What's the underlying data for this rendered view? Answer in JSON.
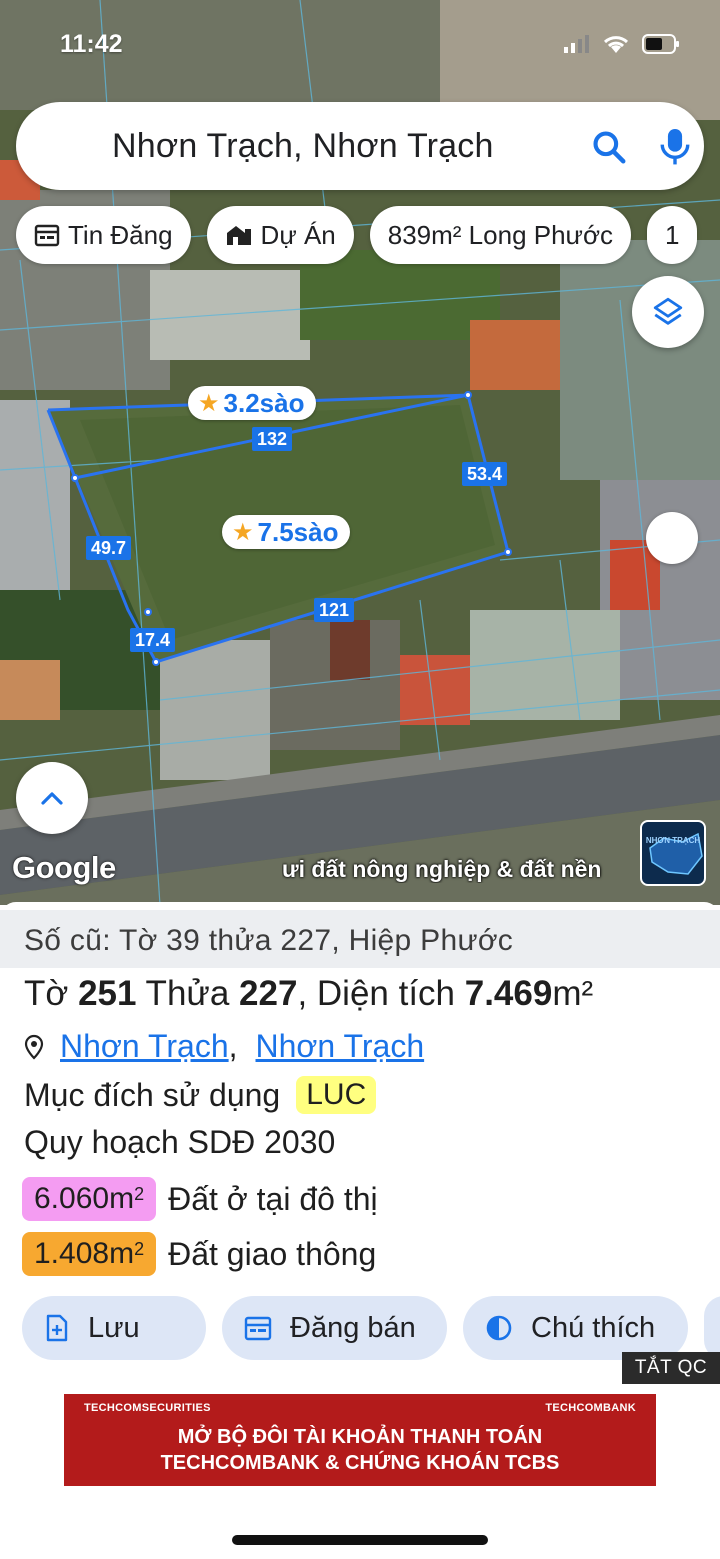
{
  "status_bar": {
    "time": "11:42"
  },
  "search": {
    "text": "Nhơn Trạch, Nhơn Trạch",
    "icon": "search-icon",
    "voice_icon": "mic-icon"
  },
  "chips": [
    {
      "label": "Tin Đăng",
      "icon": "calendar-icon"
    },
    {
      "label": "Dự Án",
      "icon": "building-icon"
    },
    {
      "label": "839m² Long Phước",
      "icon": ""
    },
    {
      "label": "1",
      "icon": ""
    }
  ],
  "map": {
    "parcel_top_label": "3.2sào",
    "parcel_main_label": "7.5sào",
    "dimensions": {
      "top": "132",
      "right": "53.4",
      "left": "49.7",
      "bottom": "121",
      "corner": "17.4"
    },
    "google": "Google",
    "caption": "ưi đất nông nghiệp & đất nền",
    "thumbnail_text": "NHƠN TRẠCH",
    "parcel_line_color": "#1a73e8"
  },
  "sheet": {
    "old_ref": "Số cũ: Tờ 39 thửa 227, Hiệp Phước",
    "title": {
      "to_label": "Tờ ",
      "to_value": "251",
      "thua_label": " Thửa ",
      "thua_value": "227",
      "area_label": ", Diện tích ",
      "area_value": "7.469",
      "area_unit": "m²"
    },
    "location": {
      "district": "Nhơn Trạch",
      "separator": ",",
      "province": "Nhơn Trạch"
    },
    "purpose": {
      "label": "Mục đích sử dụng",
      "code": "LUC"
    },
    "plan": "Quy hoạch SDĐ 2030",
    "zones": [
      {
        "area": "6.060m",
        "unit": "2",
        "label": "Đất ở tại đô thị",
        "color": "#f49cf2"
      },
      {
        "area": "1.408m",
        "unit": "2",
        "label": "Đất giao thông",
        "color": "#f7a830"
      }
    ],
    "actions": [
      {
        "label": "Lưu",
        "icon": "bookmark-add-icon"
      },
      {
        "label": "Đăng bán",
        "icon": "calendar-icon"
      },
      {
        "label": "Chú thích",
        "icon": "contrast-icon"
      }
    ]
  },
  "ad": {
    "close_label": "TẮT QC",
    "brand_left": "TECHCOMSECURITIES",
    "brand_right": "TECHCOMBANK",
    "line1": "MỞ BỘ ĐÔI TÀI KHOẢN THANH TOÁN",
    "line2": "TECHCOMBANK & CHỨNG KHOÁN TCBS"
  }
}
